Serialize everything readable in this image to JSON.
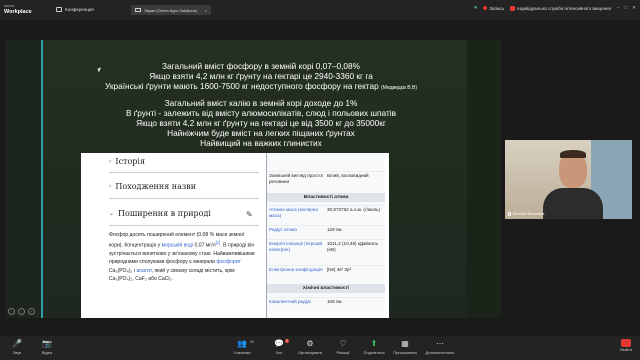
{
  "topbar": {
    "app_name_small": "zoom",
    "app_name": "Workplace",
    "conference_label": "Конференция",
    "screen_share_tab": "Экран (Green Agro Solutions)",
    "recording_label": "Запись",
    "organization": "Індивідуальна служба Інтенсивного вищення",
    "window_controls": [
      "–",
      "□",
      "✕"
    ]
  },
  "slide": {
    "paragraph1": [
      "Загальний вміст фосфору в земній корі 0,07–0,08%",
      "Якщо взяти 4,2 млн кг ґрунту на гектарі це 2940-3360 кг га",
      "Українські ґрунти мають 1600-7500 кг недоступного фосфору на гектар"
    ],
    "citation": "(Медведєв В.В)",
    "paragraph2": [
      "Загальний вміст калію в земній корі доходе до 1%",
      "В ґрунті - залежить від вмісту алюмосилікатів, слюд і польових шпатів",
      "Якщо взяти 4,2 млн кг ґрунту на гектарі це від 3500 кг до 35000кг",
      "Найніжчим буде вміст на легких піщаних ґрунтах",
      "Найвищий на важких глинистих"
    ]
  },
  "wiki": {
    "sections": [
      "Історія",
      "Походження назви",
      "Поширення в природі"
    ],
    "paragraph_parts": {
      "p1": "Фосфор досить поширений елемент (0,08 % маси земної кори). Концентрація у ",
      "link1": "морській воді",
      "p2": " 0,07 мг/л",
      "sup": "[1]",
      "p3": ". В природі він зустрічається винятково у зв'язаному стані. Найважливішими природними сполуками фосфору є мінерали ",
      "link2": "фосфорит",
      "p4": " Ca₃(PO₄)₂ і ",
      "link3": "апатит",
      "p5": ", який у своєму складі містить, крім Ca₃(PO₄)₂, CaF₂ або CaCl₂."
    },
    "infobox": {
      "rows_top": [
        {
          "k": "Зовнішній вигляд простої речовини",
          "v": "Білий, восковидний",
          "link": false
        }
      ],
      "head1": "Властивості атома",
      "rows_atom": [
        {
          "k": "Атомна маса (молярна маса)",
          "v": "30,973762 а.о.м. (г/моль)",
          "link": true
        },
        {
          "k": "Радіус атома",
          "v": "128 пм",
          "link": true
        },
        {
          "k": "Енергія іонізації (перший електрон)",
          "v": "1011,2 (10,48) кДж/моль (еВ)",
          "link": true
        },
        {
          "k": "Електронна конфігурація",
          "v": "[Ne] 3s² 3p³",
          "link": true
        }
      ],
      "head2": "Хімічні властивості",
      "rows_chem": [
        {
          "k": "Ковалентний радіус",
          "v": "106 пм",
          "link": true
        }
      ]
    }
  },
  "video": {
    "participant_name": "Віталій Філиппов"
  },
  "bottombar": {
    "items": [
      {
        "label": "Звук",
        "icon": "🎤"
      },
      {
        "label": "Відео",
        "icon": "📷"
      },
      {
        "label": "Учасники",
        "icon": "👥",
        "count": "30"
      },
      {
        "label": "Чат",
        "icon": "💬",
        "count": "2"
      },
      {
        "label": "Організувати",
        "icon": "⚙"
      },
      {
        "label": "Реакції",
        "icon": "♡"
      },
      {
        "label": "Поділитися",
        "icon": "⬆"
      },
      {
        "label": "Приложения",
        "icon": "▦"
      },
      {
        "label": "Дополнительно",
        "icon": "⋯"
      }
    ],
    "end_label": "Выйти"
  },
  "colors": {
    "slide_bg": "#243020",
    "accent_teal": "#2f9ea8",
    "link_blue": "#3366cc",
    "end_red": "#e53935",
    "share_green": "#36c25a"
  }
}
